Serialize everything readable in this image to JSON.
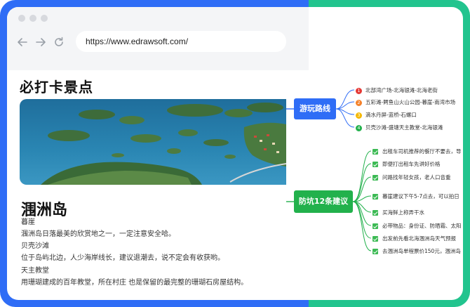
{
  "browser": {
    "url": "https://www.edrawsoft.com/"
  },
  "page": {
    "heading": "必打卡景点",
    "place_title": "涠洲岛",
    "lines": [
      "暮崖",
      "涠洲岛日落最美的欣赏地之一，一定注意安全哈。",
      "贝壳沙滩",
      "位于岛屿北边，人少海岸线长，建议退潮去，说不定会有收获哟。",
      "天主教堂",
      "用珊瑚建成的百年教堂，所在村庄  也是保留的最完整的珊瑚石房屋结构。"
    ]
  },
  "mindmap": {
    "route_node": "游玩路线",
    "routes": [
      {
        "num": "1",
        "text": "北部湾广场-北海银滩-北海老街",
        "color": "#e53935"
      },
      {
        "num": "2",
        "text": "五彩滩-鳄鱼山火山公园-暮崖-南湾市场",
        "color": "#f4812a"
      },
      {
        "num": "3",
        "text": "滴水丹屏-蓝桥-石螺口",
        "color": "#f5b800"
      },
      {
        "num": "4",
        "text": "贝壳沙滩-盛塘天主教堂-北海银滩",
        "color": "#22b14c"
      }
    ],
    "tips_node": "防坑12条建议",
    "tips": [
      "出租车司机推荐的餐厅不要去，导",
      "即便打出租车先讲好价格",
      "问路找年轻女孩，老人口音重",
      "暮崖建议下午5-7点去，可以拍日",
      "买海鲜上称弄干水",
      "必带物品：身份证、防晒霜、太阳",
      "出发前先看北海涠洲岛天气预报",
      "去涠洲岛单程票价150元，涠洲岛"
    ]
  },
  "colors": {
    "left_frame": "#2f6df6",
    "right_frame": "#22c48e",
    "route_node": "#2f6df6",
    "tips_node": "#22b14c"
  }
}
